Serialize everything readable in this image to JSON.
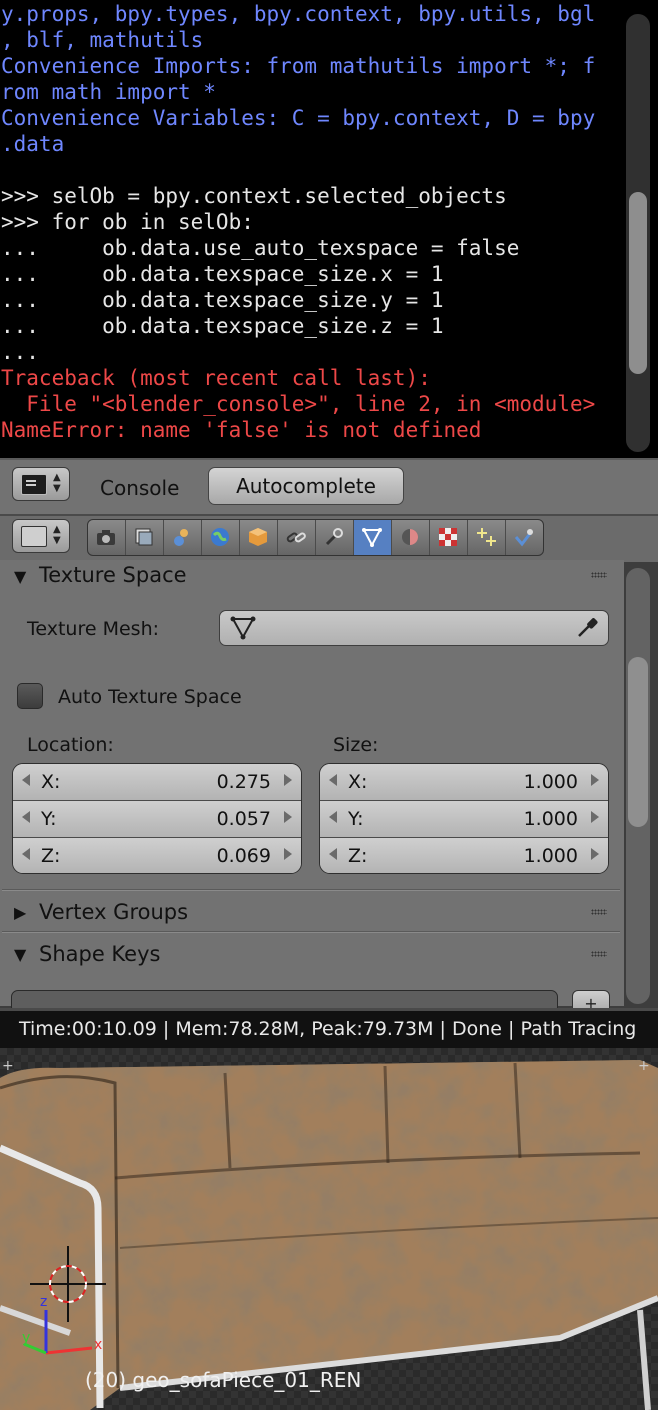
{
  "console": {
    "lines": [
      {
        "text": "y.props, bpy.types, bpy.context, bpy.utils, bgl",
        "style": "blue"
      },
      {
        "text": ", blf, mathutils",
        "style": "blue"
      },
      {
        "text": "Convenience Imports: from mathutils import *; f",
        "style": "blue"
      },
      {
        "text": "rom math import *",
        "style": "blue"
      },
      {
        "text": "Convenience Variables: C = bpy.context, D = bpy",
        "style": "blue"
      },
      {
        "text": ".data",
        "style": "blue"
      },
      {
        "text": "",
        "style": "white"
      },
      {
        "text": ">>> selOb = bpy.context.selected_objects",
        "style": "white"
      },
      {
        "text": ">>> for ob in selOb:",
        "style": "white"
      },
      {
        "text": "...     ob.data.use_auto_texspace = false",
        "style": "white"
      },
      {
        "text": "...     ob.data.texspace_size.x = 1",
        "style": "white"
      },
      {
        "text": "...     ob.data.texspace_size.y = 1",
        "style": "white"
      },
      {
        "text": "...     ob.data.texspace_size.z = 1",
        "style": "white"
      },
      {
        "text": "...",
        "style": "white"
      },
      {
        "text": "Traceback (most recent call last):",
        "style": "red"
      },
      {
        "text": "  File \"<blender_console>\", line 2, in <module>",
        "style": "red"
      },
      {
        "text": "NameError: name 'false' is not defined",
        "style": "red"
      }
    ]
  },
  "console_header": {
    "menu_label": "Console",
    "autocomplete_label": "Autocomplete"
  },
  "properties": {
    "tabs": [
      "render-icon",
      "render-layers-icon",
      "scene-icon",
      "world-icon",
      "object-icon",
      "constraints-icon",
      "modifiers-icon",
      "mesh-data-icon",
      "material-icon",
      "texture-icon",
      "particles-icon",
      "physics-icon"
    ],
    "active_tab": "mesh-data-icon",
    "texture_space": {
      "title": "Texture Space",
      "texture_mesh_label": "Texture Mesh:",
      "auto_label": "Auto Texture Space",
      "auto_checked": false,
      "location_label": "Location:",
      "size_label": "Size:",
      "location": [
        {
          "axis": "X:",
          "value": "0.275"
        },
        {
          "axis": "Y:",
          "value": "0.057"
        },
        {
          "axis": "Z:",
          "value": "0.069"
        }
      ],
      "size": [
        {
          "axis": "X:",
          "value": "1.000"
        },
        {
          "axis": "Y:",
          "value": "1.000"
        },
        {
          "axis": "Z:",
          "value": "1.000"
        }
      ]
    },
    "vertex_groups_title": "Vertex Groups",
    "shape_keys_title": "Shape Keys"
  },
  "render": {
    "status": "Time:00:10.09 | Mem:78.28M, Peak:79.73M | Done | Path Tracing",
    "object_label": "(20) geo_sofaPiece_01_REN"
  }
}
